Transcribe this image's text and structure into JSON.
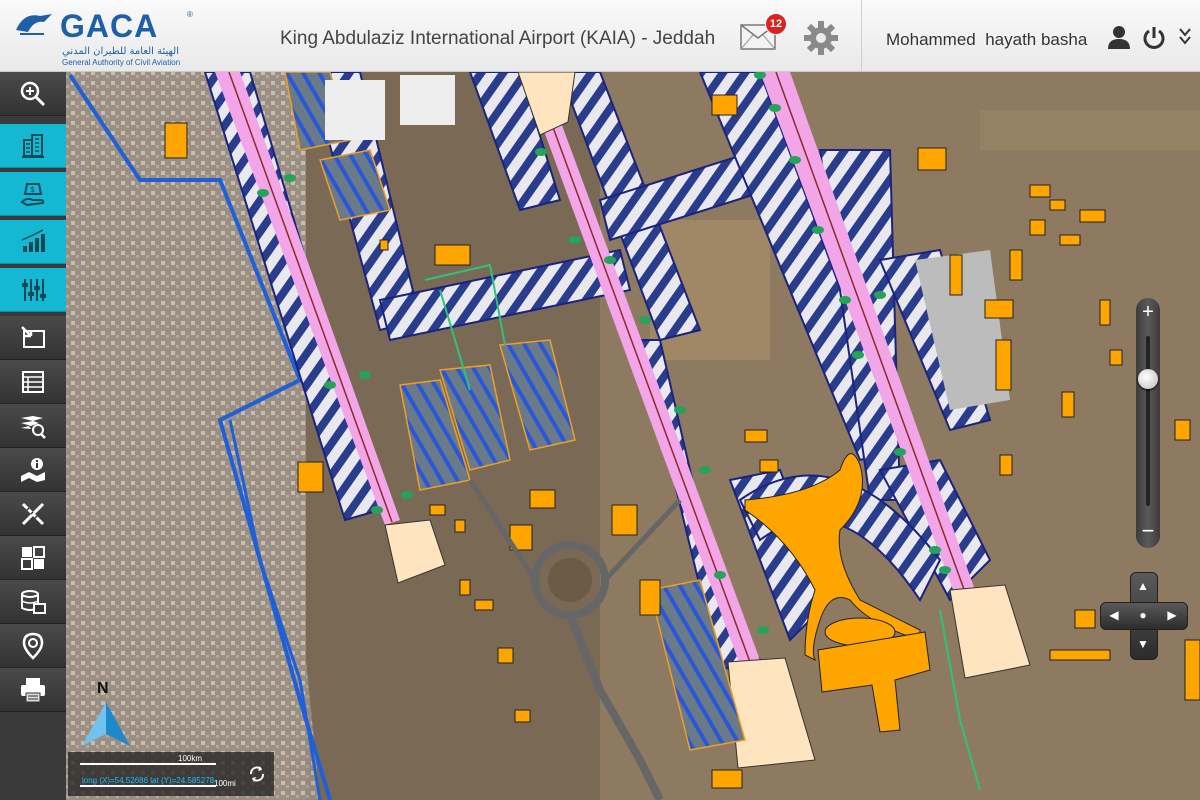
{
  "header": {
    "logo_text": "GACA",
    "logo_reg": "®",
    "logo_arabic": "الهيئة العامة للطيران المدني",
    "logo_english": "General Authority of Civil Aviation",
    "title": "King Abdulaziz International Airport (KAIA) - Jeddah",
    "mail_count": "12",
    "user_name": "Mohammed  hayath basha"
  },
  "sidebar": {
    "tools": [
      {
        "icon": "zoom-in-icon",
        "active": false
      },
      {
        "icon": "buildings-icon",
        "active": true
      },
      {
        "icon": "money-hand-icon",
        "active": true
      },
      {
        "icon": "bar-chart-icon",
        "active": true
      },
      {
        "icon": "sliders-icon",
        "active": true
      },
      {
        "icon": "map-select-icon",
        "active": false
      },
      {
        "icon": "table-icon",
        "active": false
      },
      {
        "icon": "layers-search-icon",
        "active": false
      },
      {
        "icon": "map-info-icon",
        "active": false
      },
      {
        "icon": "measure-icon",
        "active": false
      },
      {
        "icon": "dashboard-icon",
        "active": false
      },
      {
        "icon": "database-export-icon",
        "active": false
      },
      {
        "icon": "location-pin-icon",
        "active": false
      },
      {
        "icon": "print-icon",
        "active": false
      }
    ]
  },
  "map": {
    "north_label": "N",
    "scale_top": "100km",
    "scale_bottom": "100mi",
    "coordinates": "long (X)=54.52686   lat (Y)=24.585278",
    "zoom_level": 0.25
  },
  "colors": {
    "accent": "#14b8d2",
    "building": "#ffa500",
    "runway_pink": "#f2a6e8",
    "taxiway_blue": "#2a3c8c",
    "route_blue": "#1f5fd8",
    "badge": "#d92222"
  }
}
